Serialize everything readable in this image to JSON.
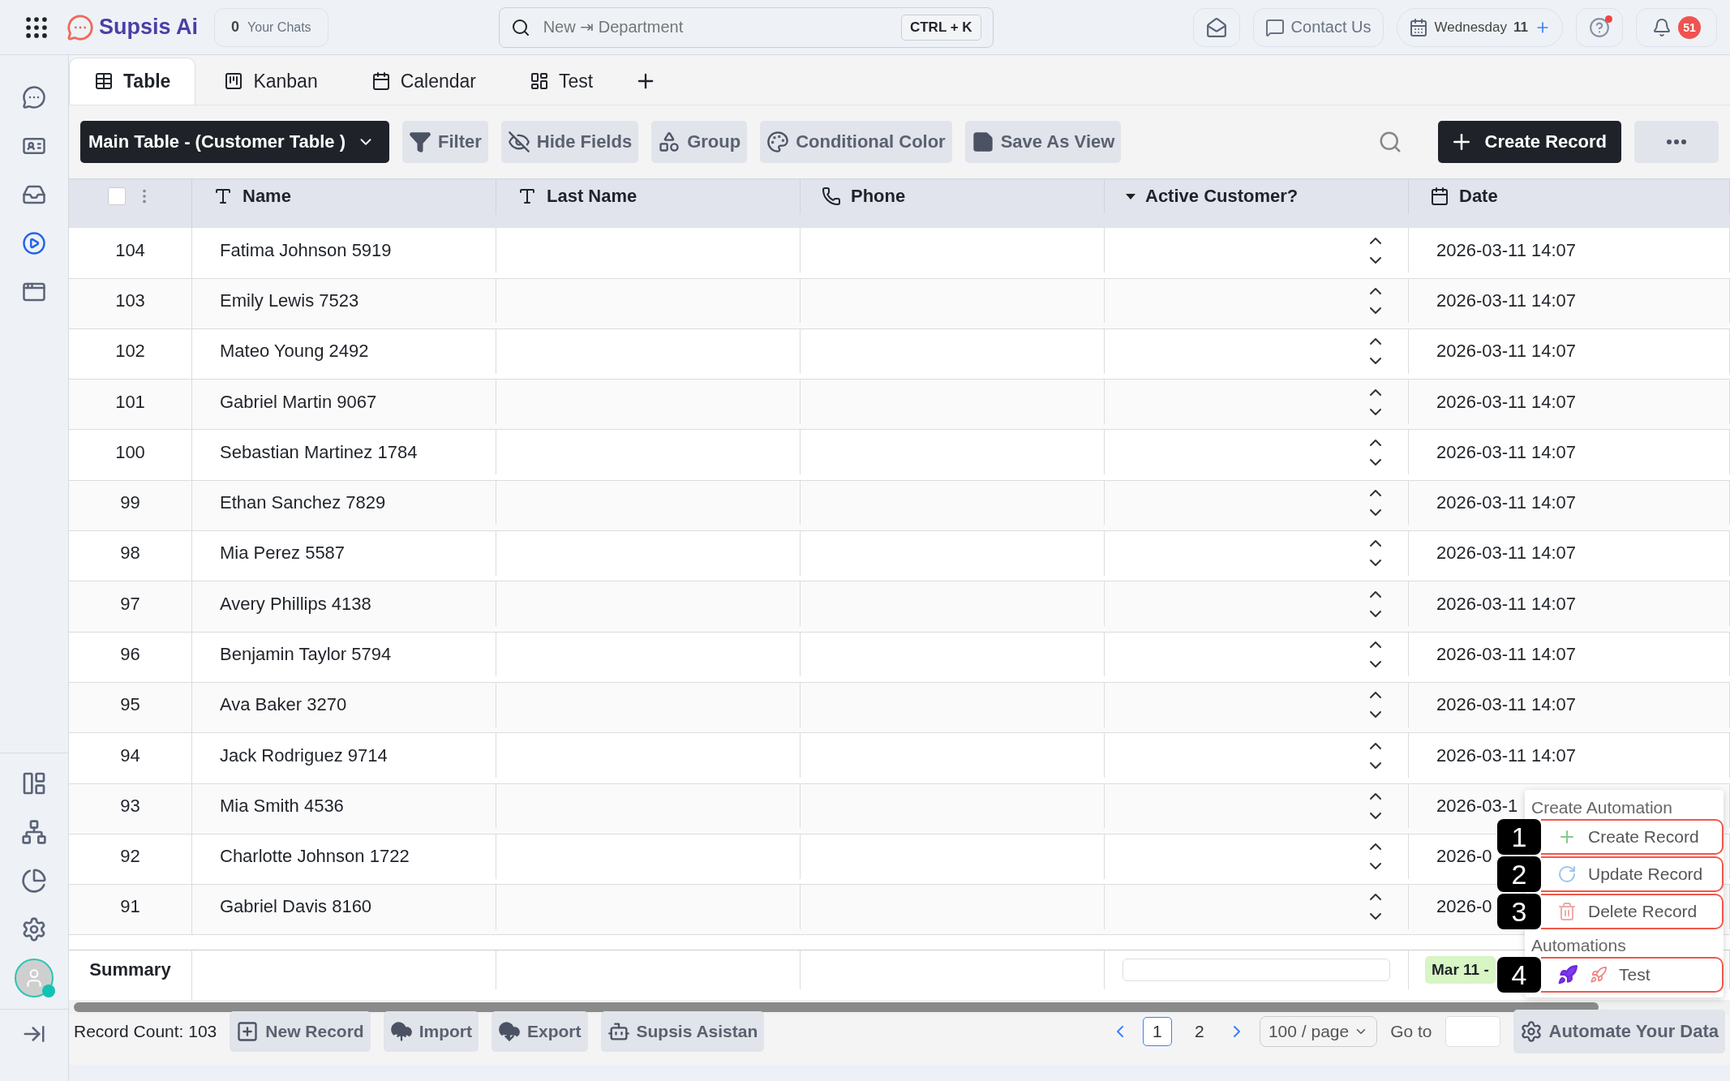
{
  "top_bar": {
    "brand": "Supsis Ai",
    "chats": {
      "count": "0",
      "label": "Your Chats"
    },
    "search": {
      "placeholder": "New ⇥ Department",
      "shortcut": "CTRL + K"
    },
    "contact": "Contact Us",
    "date": {
      "day": "Wednesday",
      "number": "11"
    },
    "help_alert": true,
    "notifications": "51"
  },
  "sidebar": {
    "items": [
      {
        "selected": false
      },
      {
        "selected": false
      },
      {
        "selected": false
      },
      {
        "selected": true
      },
      {
        "selected": false
      }
    ],
    "online": true
  },
  "tabs": [
    {
      "label": "Table",
      "selected": true
    },
    {
      "label": "Kanban",
      "selected": false
    },
    {
      "label": "Calendar",
      "selected": false
    },
    {
      "label": "Test",
      "selected": false
    }
  ],
  "toolbar": {
    "table_select": "Main Table - (Customer Table )",
    "buttons": [
      "Filter",
      "Hide Fields",
      "Group",
      "Conditional Color",
      "Save As View"
    ],
    "create": "Create Record"
  },
  "table": {
    "select_all": {
      "checked": false
    },
    "columns": [
      {
        "label": "Name",
        "kind": "text"
      },
      {
        "label": "Last Name",
        "kind": "text"
      },
      {
        "label": "Phone",
        "kind": "phone"
      },
      {
        "label": "Active Customer?",
        "kind": "select"
      },
      {
        "label": "Date",
        "kind": "date"
      }
    ],
    "rows": [
      {
        "id": "104",
        "name": "Fatima Johnson 5919",
        "date": "2026-03-11 14:07"
      },
      {
        "id": "103",
        "name": "Emily Lewis 7523",
        "date": "2026-03-11 14:07"
      },
      {
        "id": "102",
        "name": "Mateo Young 2492",
        "date": "2026-03-11 14:07"
      },
      {
        "id": "101",
        "name": "Gabriel Martin 9067",
        "date": "2026-03-11 14:07"
      },
      {
        "id": "100",
        "name": "Sebastian Martinez 1784",
        "date": "2026-03-11 14:07"
      },
      {
        "id": "99",
        "name": "Ethan Sanchez 7829",
        "date": "2026-03-11 14:07"
      },
      {
        "id": "98",
        "name": "Mia Perez 5587",
        "date": "2026-03-11 14:07"
      },
      {
        "id": "97",
        "name": "Avery Phillips 4138",
        "date": "2026-03-11 14:07"
      },
      {
        "id": "96",
        "name": "Benjamin Taylor 5794",
        "date": "2026-03-11 14:07"
      },
      {
        "id": "95",
        "name": "Ava Baker 3270",
        "date": "2026-03-11 14:07"
      },
      {
        "id": "94",
        "name": "Jack Rodriguez 9714",
        "date": "2026-03-11 14:07"
      },
      {
        "id": "93",
        "name": "Mia Smith 4536",
        "date": "2026-03-1"
      },
      {
        "id": "92",
        "name": "Charlotte Johnson 1722",
        "date": "2026-0"
      },
      {
        "id": "91",
        "name": "Gabriel Davis 8160",
        "date": "2026-0"
      }
    ],
    "summary": {
      "label": "Summary",
      "date_range": "Mar 11 -"
    }
  },
  "footer": {
    "record_count": "Record Count: 103",
    "buttons": [
      "New Record",
      "Import",
      "Export",
      "Supsis Asistan"
    ],
    "pages": [
      {
        "label": "1",
        "selected": true
      },
      {
        "label": "2",
        "selected": false
      }
    ],
    "page_size": "100 / page",
    "goto": "Go to",
    "automate": "Automate Your Data"
  },
  "popup": {
    "sections": [
      {
        "title": "Create Automation",
        "items": [
          {
            "marker": "1",
            "label": "Create Record",
            "kind": "create"
          },
          {
            "marker": "2",
            "label": "Update Record",
            "kind": "update"
          },
          {
            "marker": "3",
            "label": "Delete Record",
            "kind": "delete"
          }
        ]
      },
      {
        "title": "Automations",
        "items": [
          {
            "marker": "4",
            "label": "Test",
            "kind": "automation"
          }
        ]
      }
    ]
  }
}
